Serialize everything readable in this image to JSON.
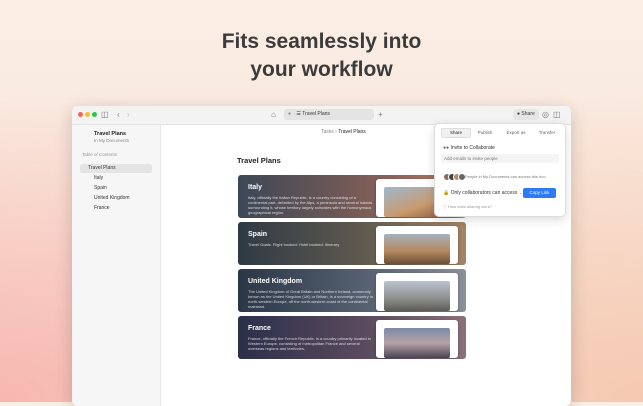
{
  "headline": [
    "Fits seamlessly into",
    "your workflow"
  ],
  "window": {
    "tab_title": "Travel Plans",
    "share_label": "Share"
  },
  "sidebar": {
    "doc_title": "Travel Plans",
    "doc_location": "In My Documents",
    "toc_label": "Table of Contents",
    "items": [
      {
        "label": "Travel Plans",
        "active": true
      },
      {
        "label": "Italy"
      },
      {
        "label": "Spain"
      },
      {
        "label": "United Kingdom"
      },
      {
        "label": "France"
      }
    ]
  },
  "breadcrumb": {
    "parent": "Tasks",
    "separator": "›",
    "current": "Travel Plans"
  },
  "document": {
    "title": "Travel Plans",
    "cards": [
      {
        "title": "Italy",
        "description": "Italy, officially the Italian Republic, is a country consisting of a continental part, delimited by the Alps, a peninsula and several islands surrounding it, whose territory largely coincides with the homonymous geographical region."
      },
      {
        "title": "Spain",
        "description": "Travel Goals: Flight booked: Hotel booked: Itinerary"
      },
      {
        "title": "United Kingdom",
        "description": "The United Kingdom of Great Britain and Northern Ireland, commonly known as the United Kingdom (UK) or Britain, is a sovereign country in north-western Europe, off the north-western coast of the continental mainland."
      },
      {
        "title": "France",
        "description": "France, officially the French Republic, is a country primarily located in Western Europe, consisting of metropolitan France and several overseas regions and territories."
      }
    ]
  },
  "share_popover": {
    "tabs": [
      "Share",
      "Publish",
      "Export as",
      "Transfer"
    ],
    "invite_title": "Invite to Collaborate",
    "email_placeholder": "Add emails to invite people",
    "people_text": "People in My Documents can access this doc",
    "access_text": "Only collaborators can access",
    "copy_button": "Copy Link",
    "help_text": "How does sharing work?"
  },
  "colors": {
    "accent": "#2f7bf5",
    "close": "#ff5f57",
    "minimize": "#febc2e",
    "zoom": "#28c840"
  },
  "icons": [
    "sidebar-toggle-icon",
    "back-arrow-icon",
    "forward-arrow-icon",
    "home-icon",
    "lock-icon",
    "plus-icon",
    "person-icon",
    "bell-icon",
    "sidebar-right-icon",
    "document-icon",
    "users-icon"
  ]
}
